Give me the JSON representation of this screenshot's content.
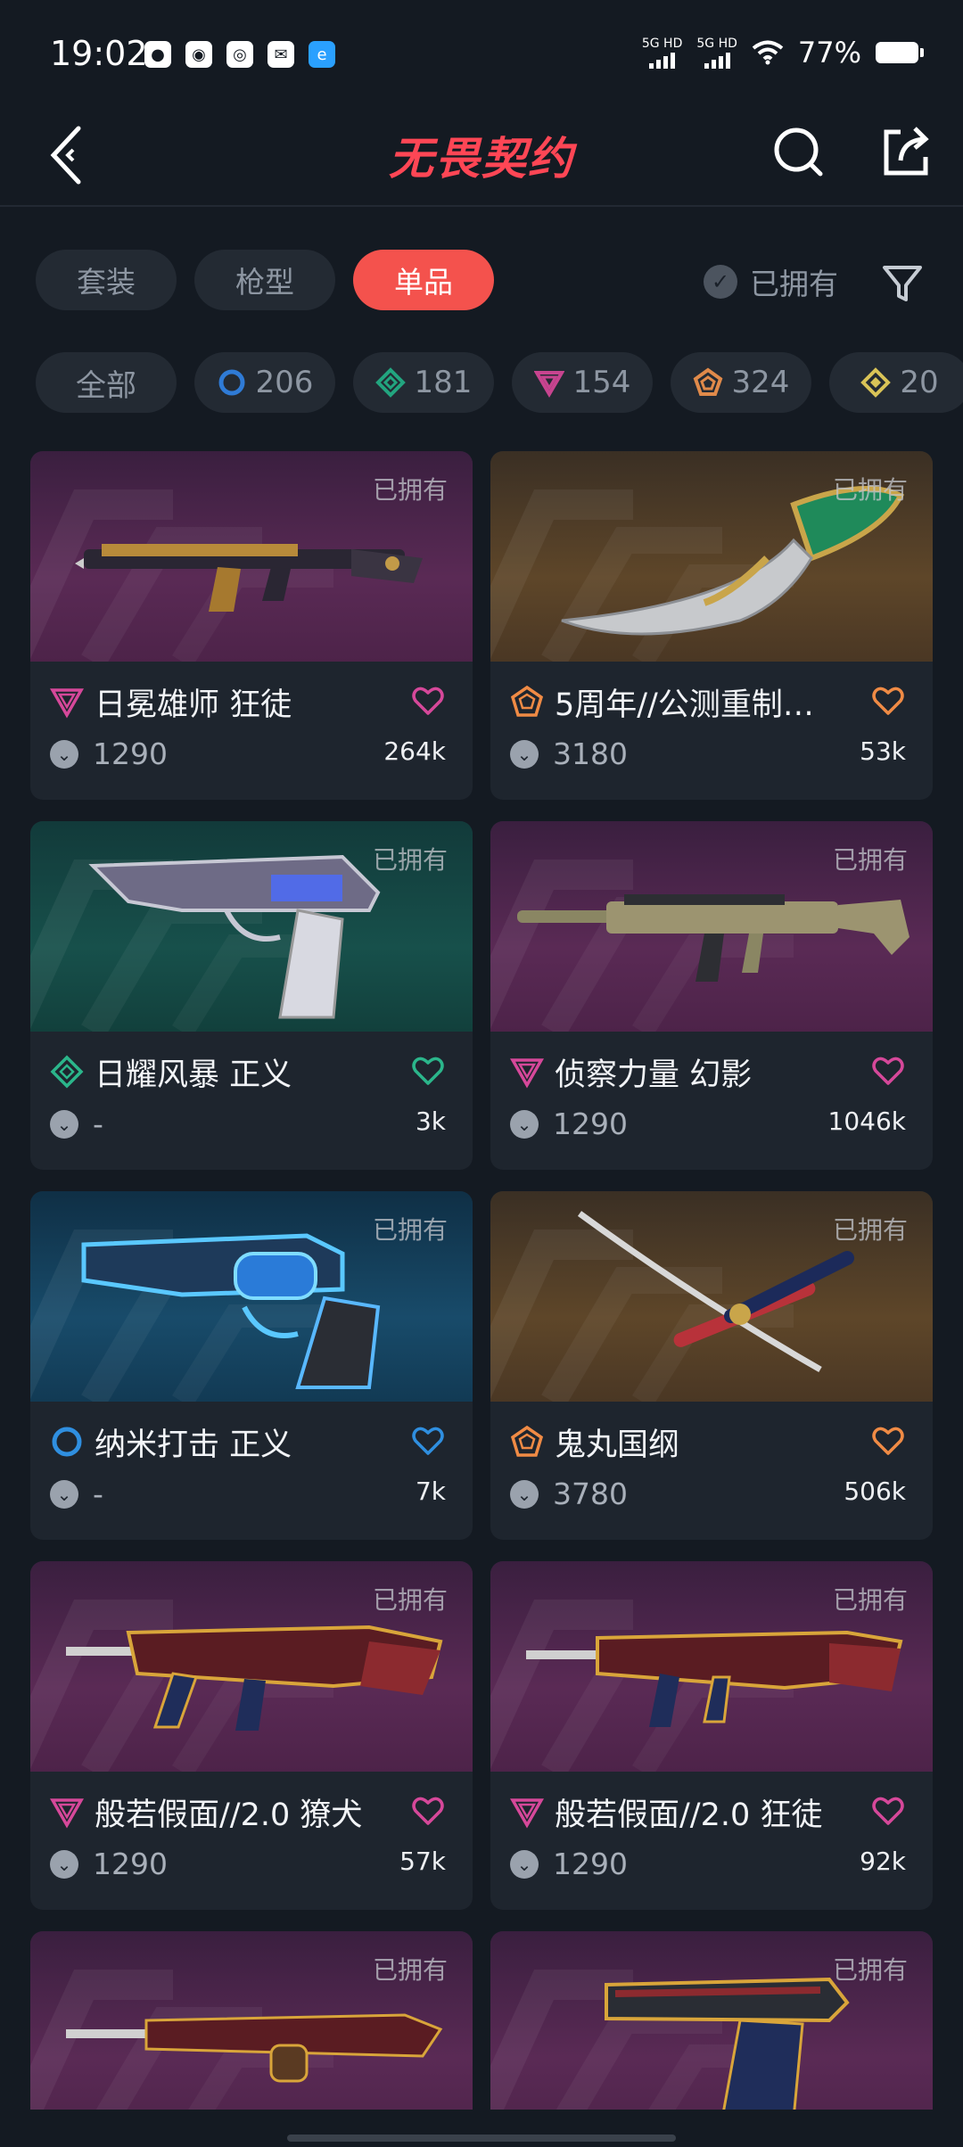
{
  "status": {
    "time": "19:02",
    "net1": "5G HD",
    "net2": "5G HD",
    "battery": "77%"
  },
  "header": {
    "title": "无畏契约"
  },
  "tabs": [
    {
      "label": "套装",
      "active": false
    },
    {
      "label": "枪型",
      "active": false
    },
    {
      "label": "单品",
      "active": true
    }
  ],
  "owned_filter": {
    "label": "已拥有"
  },
  "chips": [
    {
      "label": "全部"
    },
    {
      "label": "206",
      "tier": "select",
      "color": "#2f7bd6"
    },
    {
      "label": "181",
      "tier": "deluxe",
      "color": "#22a57f"
    },
    {
      "label": "154",
      "tier": "premium",
      "color": "#c7448f"
    },
    {
      "label": "324",
      "tier": "exclusive",
      "color": "#e08a4a"
    },
    {
      "label": "20",
      "tier": "ultra",
      "color": "#d9c357"
    }
  ],
  "owned_tag": "已拥有",
  "items": [
    {
      "name": "日冕雄师 狂徒",
      "tier": "premium",
      "tier_color": "#d6489a",
      "price": "1290",
      "likes": "264k",
      "bg": "purple",
      "weapon": "rifle-gold"
    },
    {
      "name": "5周年//公测重制…",
      "tier": "exclusive",
      "tier_color": "#f08b45",
      "price": "3180",
      "likes": "53k",
      "bg": "gold",
      "weapon": "knife-green"
    },
    {
      "name": "日耀风暴 正义",
      "tier": "deluxe",
      "tier_color": "#2bb68b",
      "price": "-",
      "likes": "3k",
      "bg": "teal",
      "weapon": "pistol-chrome"
    },
    {
      "name": "侦察力量 幻影",
      "tier": "premium",
      "tier_color": "#d6489a",
      "price": "1290",
      "likes": "1046k",
      "bg": "purple",
      "weapon": "rifle-tan"
    },
    {
      "name": "纳米打击 正义",
      "tier": "select",
      "tier_color": "#2f8fe0",
      "price": "-",
      "likes": "7k",
      "bg": "blue",
      "weapon": "revolver-blue"
    },
    {
      "name": "鬼丸国纲",
      "tier": "exclusive",
      "tier_color": "#f08b45",
      "price": "3780",
      "likes": "506k",
      "bg": "gold",
      "weapon": "katana"
    },
    {
      "name": "般若假面//2.0 獠犬",
      "tier": "premium",
      "tier_color": "#d6489a",
      "price": "1290",
      "likes": "57k",
      "bg": "purple",
      "weapon": "smg-red"
    },
    {
      "name": "般若假面//2.0 狂徒",
      "tier": "premium",
      "tier_color": "#d6489a",
      "price": "1290",
      "likes": "92k",
      "bg": "purple",
      "weapon": "rifle-red"
    },
    {
      "name": "",
      "tier": "premium",
      "tier_color": "#d6489a",
      "price": "",
      "likes": "",
      "bg": "purple",
      "weapon": "shotgun-red"
    },
    {
      "name": "",
      "tier": "premium",
      "tier_color": "#d6489a",
      "price": "",
      "likes": "",
      "bg": "purple",
      "weapon": "pistol-red"
    }
  ]
}
